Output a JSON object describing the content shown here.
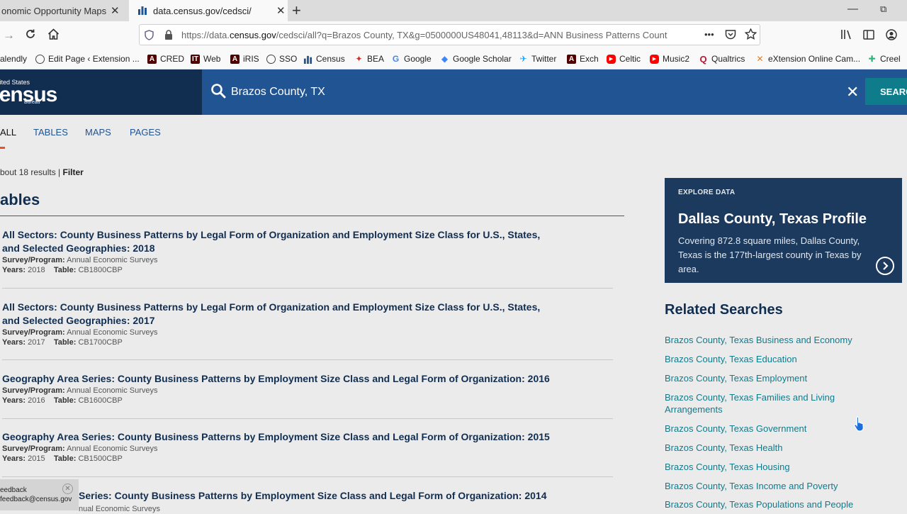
{
  "browser": {
    "tabs": [
      {
        "title": "onomic Opportunity Maps |",
        "close": "✕"
      },
      {
        "title": "data.census.gov/cedsci/",
        "close": "✕"
      }
    ],
    "new_tab": "+",
    "window_min": "—",
    "window_max": "⧉",
    "url_prefix": "https://data.",
    "url_domain": "census.gov",
    "url_rest": "/cedsci/all?q=Brazos County, TX&g=0500000US48041,48113&d=ANN Business Patterns Count",
    "url_more": "•••",
    "bookmarks": [
      {
        "label": "alendly",
        "icon": "calendly-icon",
        "color": "#ffffff"
      },
      {
        "label": "Edit Page ‹ Extension ...",
        "icon": "globe-icon",
        "color": "#ffffff"
      },
      {
        "label": "CRED",
        "icon": "tamu-icon",
        "color": "#500000"
      },
      {
        "label": "Web",
        "icon": "it-icon",
        "color": "#500000"
      },
      {
        "label": "iRIS",
        "icon": "tamu-icon",
        "color": "#500000"
      },
      {
        "label": "SSO",
        "icon": "globe-icon",
        "color": "#ffffff"
      },
      {
        "label": "Census",
        "icon": "census-bars-icon",
        "color": "#205493"
      },
      {
        "label": "BEA",
        "icon": "bea-icon",
        "color": "#c0392b"
      },
      {
        "label": "Google",
        "icon": "google-icon",
        "color": "#4285f4"
      },
      {
        "label": "Google Scholar",
        "icon": "scholar-icon",
        "color": "#4285f4"
      },
      {
        "label": "Twitter",
        "icon": "twitter-icon",
        "color": "#1da1f2"
      },
      {
        "label": "Exch",
        "icon": "tamu-icon",
        "color": "#500000"
      },
      {
        "label": "Celtic",
        "icon": "youtube-icon",
        "color": "#ff0000"
      },
      {
        "label": "Music2",
        "icon": "youtube-icon",
        "color": "#ff0000"
      },
      {
        "label": "Qualtrics",
        "icon": "qualtrics-icon",
        "color": "#c41230"
      },
      {
        "label": "eXtension Online Cam...",
        "icon": "extension-icon",
        "color": "#e67e22"
      },
      {
        "label": "Creel",
        "icon": "slack-icon",
        "color": "#2eb67d"
      }
    ]
  },
  "header": {
    "logo_small": "United States",
    "logo_big": "Census",
    "logo_bureau": "Bureau",
    "search_value": "Brazos County, TX",
    "clear": "✕",
    "search_button": "SEARCH"
  },
  "result_tabs": [
    "ALL",
    "TABLES",
    "MAPS",
    "PAGES"
  ],
  "results_count": "bout 18 results |",
  "filter_label": "Filter",
  "section_title": "ables",
  "results": [
    {
      "title": "All Sectors: County Business Patterns  by Legal Form of Organization and Employment Size Class for U.S., States, and Selected Geographies: 2018",
      "survey_label": "Survey/Program:",
      "survey": "Annual Economic Surveys",
      "years_label": "Years:",
      "years": "2018",
      "table_label": "Table:",
      "table": "CB1800CBP"
    },
    {
      "title": "All Sectors: County Business Patterns  by Legal Form of Organization and Employment Size Class for U.S., States, and Selected Geographies: 2017",
      "survey_label": "Survey/Program:",
      "survey": "Annual Economic Surveys",
      "years_label": "Years:",
      "years": "2017",
      "table_label": "Table:",
      "table": "CB1700CBP"
    },
    {
      "title": "Geography Area Series: County Business Patterns by Employment Size Class and Legal Form of Organization: 2016",
      "survey_label": "Survey/Program:",
      "survey": "Annual Economic Surveys",
      "years_label": "Years:",
      "years": "2016",
      "table_label": "Table:",
      "table": "CB1600CBP"
    },
    {
      "title": "Geography Area Series: County Business Patterns by Employment Size Class and Legal Form of Organization: 2015",
      "survey_label": "Survey/Program:",
      "survey": "Annual Economic Surveys",
      "years_label": "Years:",
      "years": "2015",
      "table_label": "Table:",
      "table": "CB1500CBP"
    },
    {
      "title": "Series: County Business Patterns by Employment Size Class and Legal Form of Organization: 2014",
      "survey_label": "",
      "survey": "nual Economic Surveys",
      "years_label": "",
      "years": "",
      "table_label": "",
      "table": ""
    }
  ],
  "explore": {
    "label": "EXPLORE DATA",
    "title": "Dallas County, Texas Profile",
    "description": "Covering 872.8 square miles, Dallas County, Texas is the 177th-largest county in Texas by area."
  },
  "related": {
    "title": "Related Searches",
    "items": [
      "Brazos County, Texas Business and Economy",
      "Brazos County, Texas Education",
      "Brazos County, Texas Employment",
      "Brazos County, Texas Families and Living Arrangements",
      "Brazos County, Texas Government",
      "Brazos County, Texas Health",
      "Brazos County, Texas Housing",
      "Brazos County, Texas Income and Poverty",
      "Brazos County, Texas Populations and People"
    ]
  },
  "feedback": {
    "title": "eedback",
    "email": "feedback@census.gov",
    "close": "✕"
  },
  "colors": {
    "census_navy": "#112e51",
    "census_blue": "#205493",
    "teal": "#0f7c8c",
    "accent_orange": "#e5532d"
  }
}
